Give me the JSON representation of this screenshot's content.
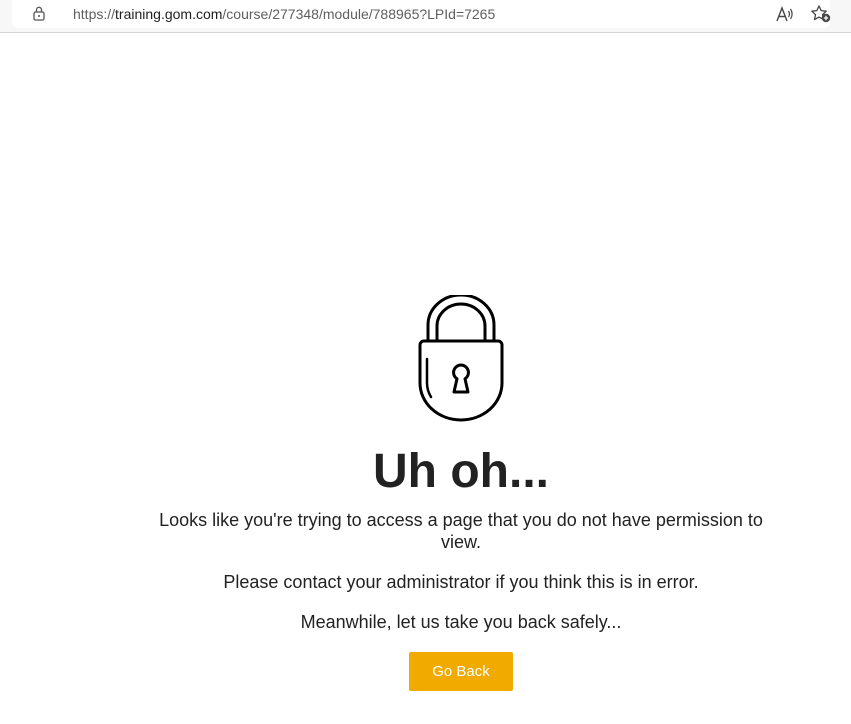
{
  "browser": {
    "url_prefix": "https://",
    "url_domain": "training.gom.com",
    "url_path": "/course/277348/module/788965?LPId=7265",
    "icons": {
      "site_info": "lock-icon",
      "read_aloud": "read-aloud-icon",
      "favorite": "add-favorite-icon"
    }
  },
  "page": {
    "icon": "padlock-icon",
    "heading": "Uh oh...",
    "message_line1": "Looks like you're trying to access a page that you do not have permission to view.",
    "message_line2": "Please contact your administrator if you think this is in error.",
    "message_line3": "Meanwhile, let us take you back safely...",
    "button_label": "Go Back"
  },
  "colors": {
    "button_bg": "#f0aa00",
    "text": "#222222"
  }
}
